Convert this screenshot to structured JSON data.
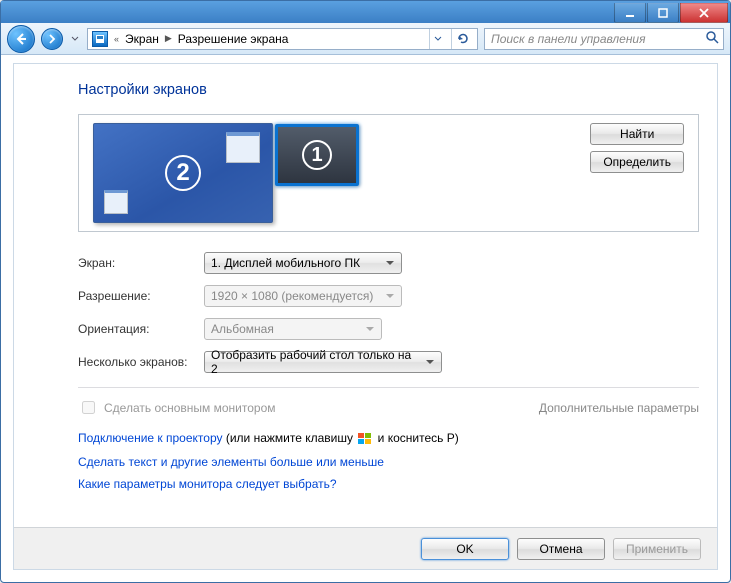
{
  "nav": {
    "breadcrumb_root": "«",
    "breadcrumb_1": "Экран",
    "breadcrumb_2": "Разрешение экрана",
    "search_placeholder": "Поиск в панели управления"
  },
  "heading": "Настройки экранов",
  "buttons": {
    "find": "Найти",
    "detect": "Определить",
    "ok": "OK",
    "cancel": "Отмена",
    "apply": "Применить"
  },
  "displays": {
    "monitor1_num": "1",
    "monitor2_num": "2"
  },
  "labels": {
    "screen": "Экран:",
    "resolution": "Разрешение:",
    "orientation": "Ориентация:",
    "multi": "Несколько экранов:"
  },
  "values": {
    "screen": "1. Дисплей мобильного ПК",
    "resolution": "1920 × 1080 (рекомендуется)",
    "orientation": "Альбомная",
    "multi": "Отобразить рабочий стол только на 2"
  },
  "checkbox_label": "Сделать основным монитором",
  "advanced_link": "Дополнительные параметры",
  "projector": {
    "link": "Подключение к проектору",
    "suffix_1": " (или нажмите клавишу ",
    "suffix_2": " и коснитесь P)"
  },
  "link_text_size": "Сделать текст и другие элементы больше или меньше",
  "link_which_monitor": "Какие параметры монитора следует выбрать?"
}
